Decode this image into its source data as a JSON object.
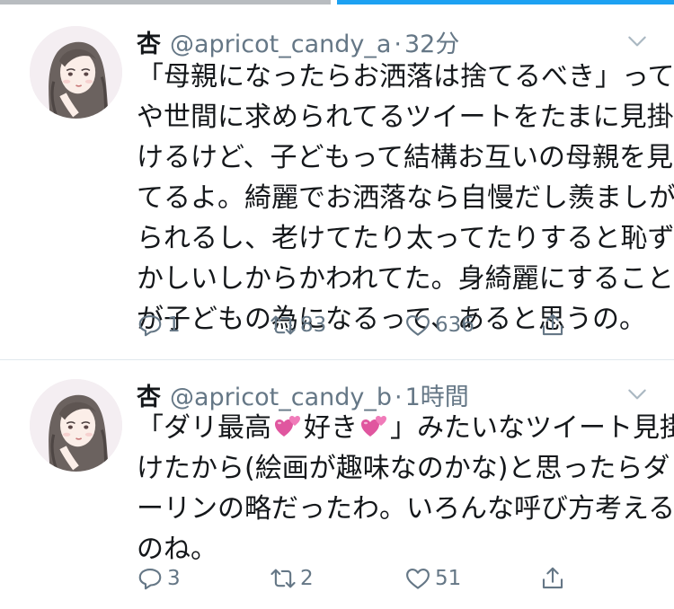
{
  "colors": {
    "accent": "#1da1f2",
    "text": "#14171a",
    "secondary": "#657786",
    "divider": "#e1e8ed",
    "emoji_heart": "#e0569f"
  },
  "tweets": [
    {
      "name": "杏",
      "handle": "@apricot_candy_a",
      "dot": "·",
      "time": "32分",
      "lines": [
        "「母親になったらお洒落は捨てるべき」って夫",
        "や世間に求められてるツイートをたまに見掛",
        "けるけど、子どもって結構お互いの母親を見",
        "てるよ。綺麗でお洒落なら自慢だし羨ましが",
        "られるし、老けてたり太ってたりすると恥ず",
        "かしいしからかわれてた。身綺麗にすること",
        "が子どもの為になるって、あると思うの。"
      ],
      "replies": "1",
      "retweets": "83",
      "likes": "636"
    },
    {
      "name": "杏",
      "handle": "@apricot_candy_b",
      "dot": "·",
      "time": "1時間",
      "line1_a": "「ダリ最高",
      "line1_b": "好き",
      "line1_c": "」みたいなツイート見掛",
      "lines_rest": [
        "けたから(絵画が趣味なのかな)と思ったらダ",
        "ーリンの略だったわ。いろんな呼び方考える",
        "のね。"
      ],
      "emoji": "two-hearts-emoji",
      "replies": "3",
      "retweets": "2",
      "likes": "51"
    }
  ],
  "icons": [
    "chevron-down-icon",
    "reply-icon",
    "retweet-icon",
    "like-icon",
    "share-icon",
    "avatar-illustration"
  ]
}
